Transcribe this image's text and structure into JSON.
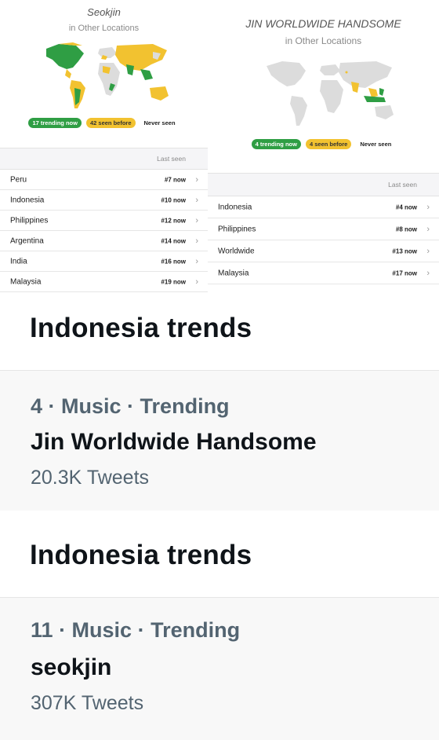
{
  "left_panel": {
    "title": "Seokjin",
    "subtitle": "in Other Locations",
    "legend": {
      "trending": "17 trending now",
      "seen_before": "42 seen before",
      "never": "Never seen"
    },
    "last_seen_header": "Last seen",
    "rows": [
      {
        "country": "Peru",
        "rank": "#7 now"
      },
      {
        "country": "Indonesia",
        "rank": "#10 now"
      },
      {
        "country": "Philippines",
        "rank": "#12 now"
      },
      {
        "country": "Argentina",
        "rank": "#14 now"
      },
      {
        "country": "India",
        "rank": "#16 now"
      },
      {
        "country": "Malaysia",
        "rank": "#19 now"
      }
    ]
  },
  "right_panel": {
    "title": "JIN WORLDWIDE HANDSOME",
    "subtitle": "in Other Locations",
    "legend": {
      "trending": "4 trending now",
      "seen_before": "4 seen before",
      "never": "Never seen"
    },
    "last_seen_header": "Last seen",
    "rows": [
      {
        "country": "Indonesia",
        "rank": "#4 now"
      },
      {
        "country": "Philippines",
        "rank": "#8 now"
      },
      {
        "country": "Worldwide",
        "rank": "#13 now"
      },
      {
        "country": "Malaysia",
        "rank": "#17 now"
      }
    ]
  },
  "trend_1": {
    "header": "Indonesia trends",
    "rank": "4",
    "category": "· Music · Trending",
    "name": "Jin Worldwide Handsome",
    "tweets": "20.3K Tweets"
  },
  "trend_2": {
    "header": "Indonesia trends",
    "rank": "11",
    "category": "· Music · Trending",
    "name": "seokjin",
    "tweets": "307K Tweets"
  },
  "icons": {
    "chevron": "chevron-right-icon"
  },
  "colors": {
    "trending": "#2f9e44",
    "seen_before": "#f2c230",
    "land": "#dcdcdc"
  }
}
